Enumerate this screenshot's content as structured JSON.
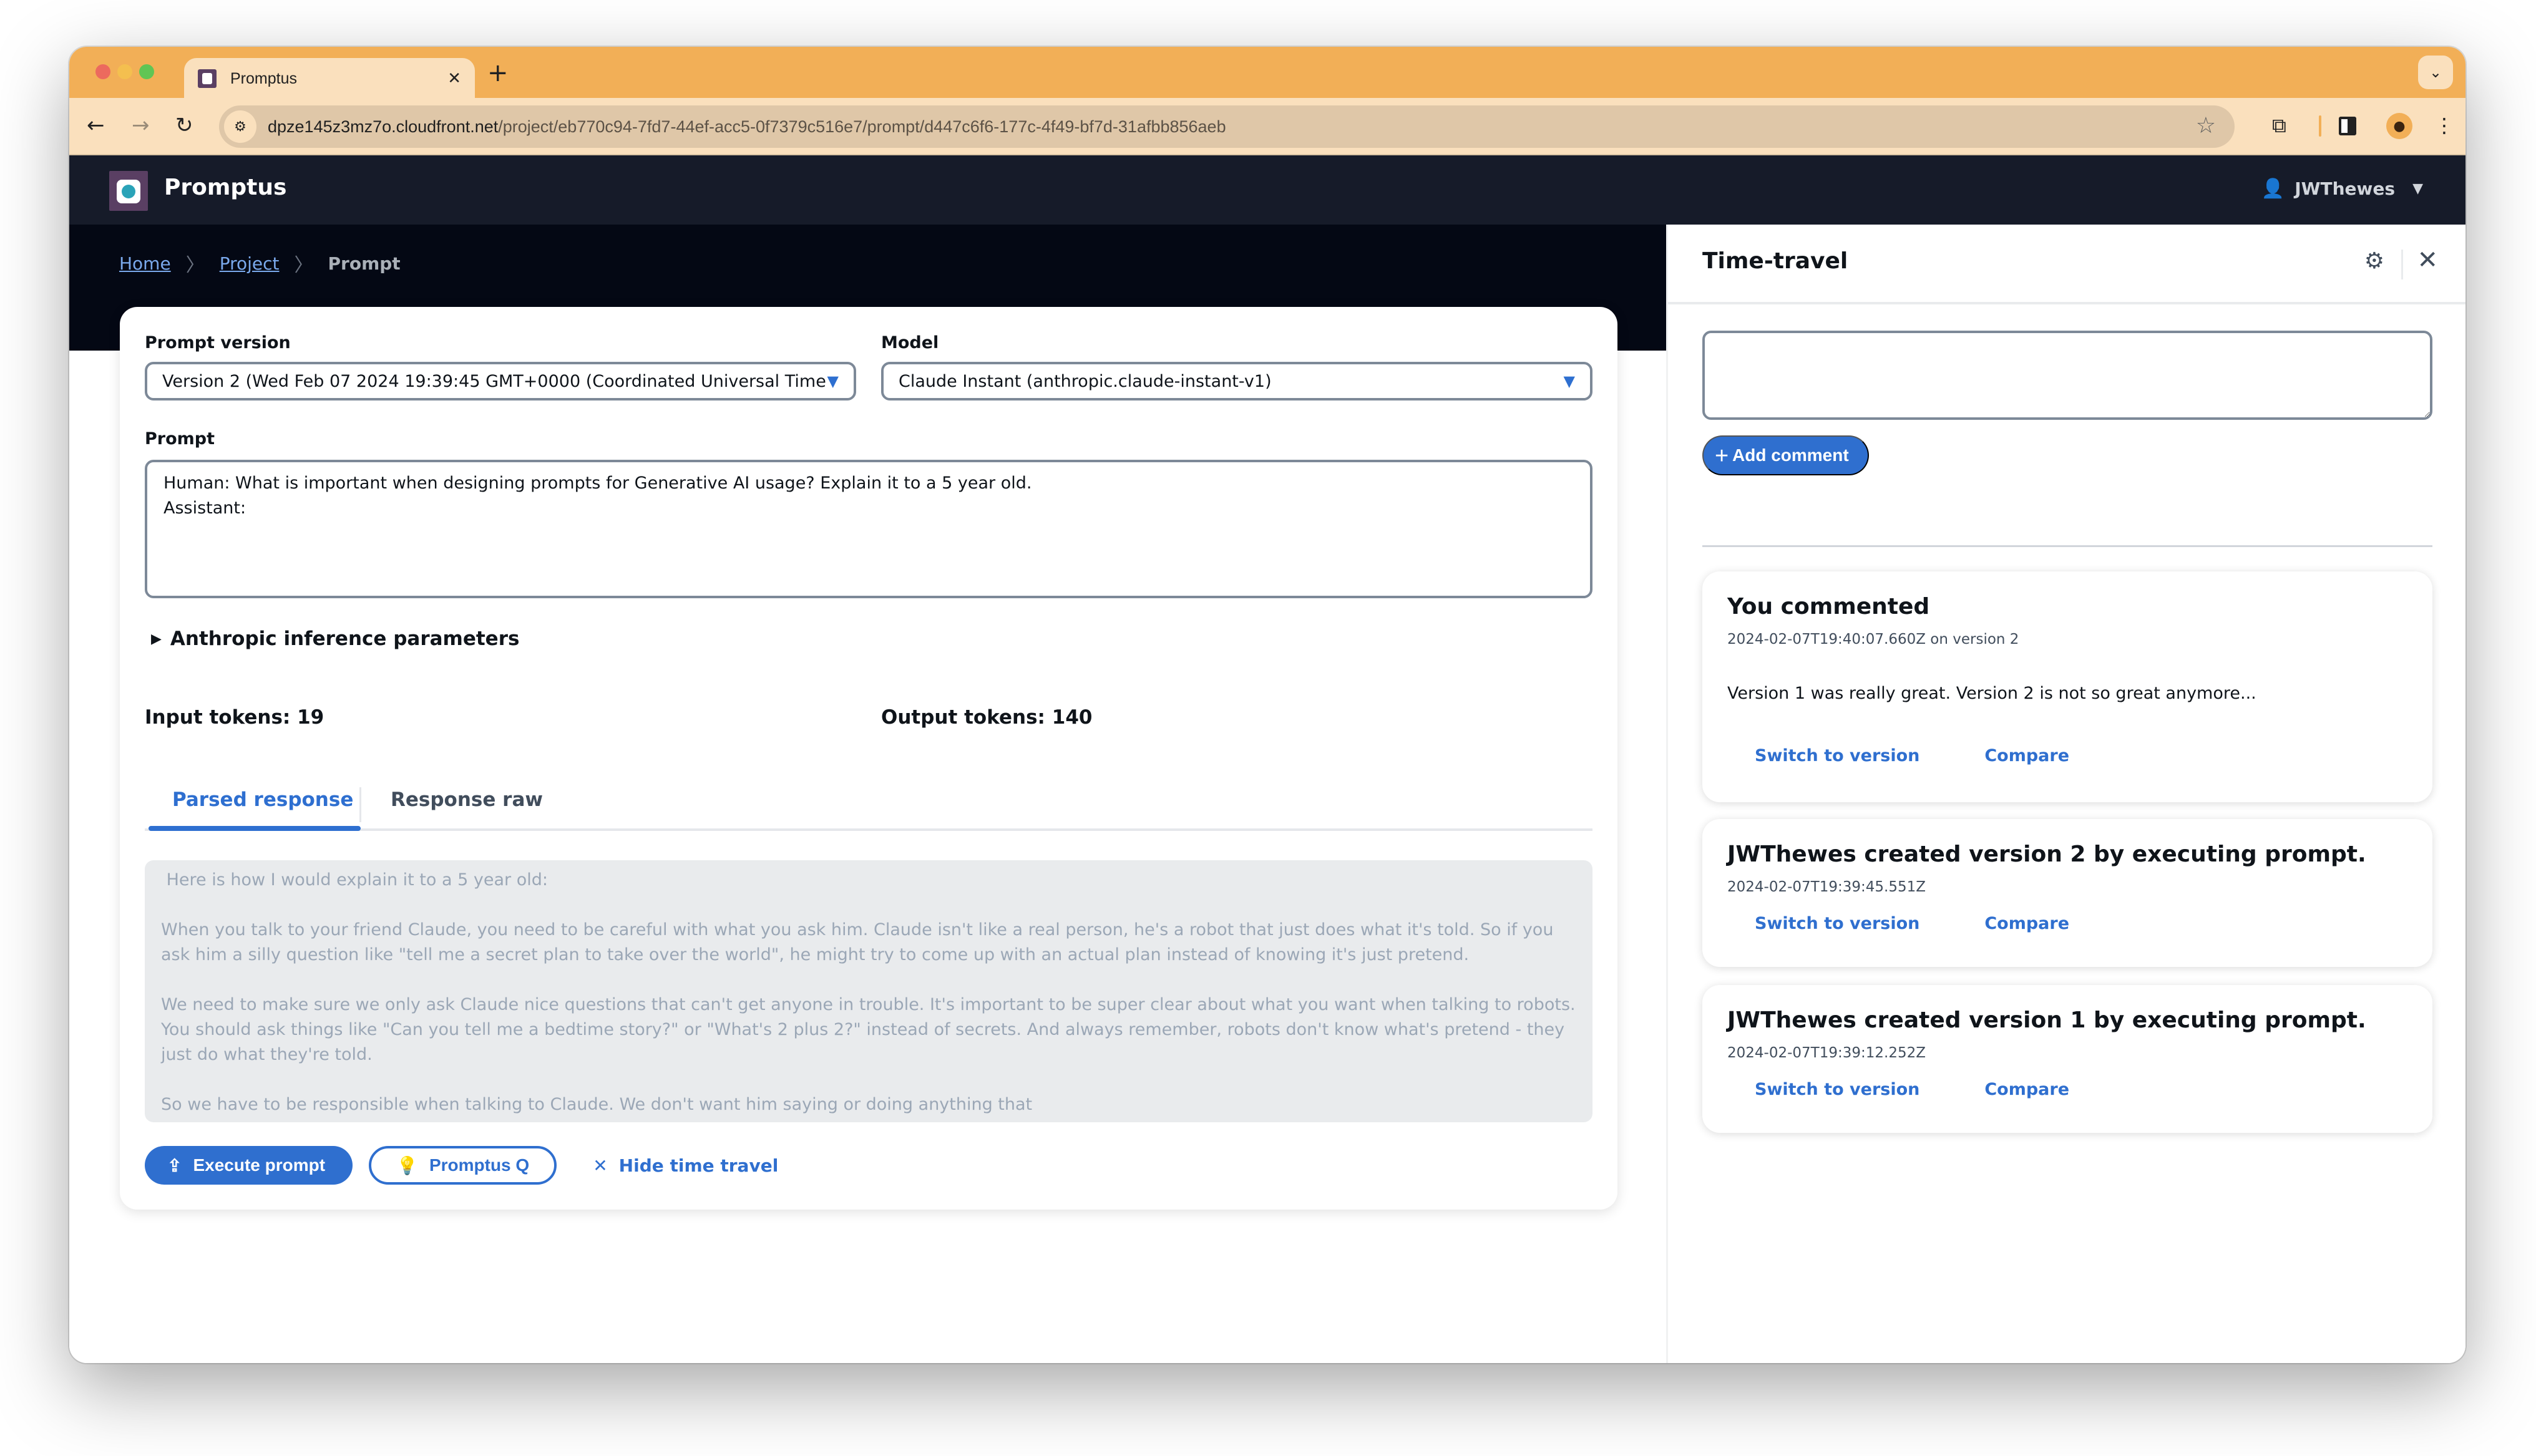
{
  "browser": {
    "tab_title": "Promptus",
    "new_tab_symbol": "+",
    "url_host": "dpze145z3mz7o.cloudfront.net",
    "url_path": "/project/eb770c94-7fd7-44ef-acc5-0f7379c516e7/prompt/d447c6f6-177c-4f49-bf7d-31afbb856aeb",
    "icons": {
      "back": "←",
      "forward": "→",
      "reload": "↻",
      "site_info": "⚙",
      "star": "☆",
      "extensions": "⧉",
      "profile": "●",
      "menu": "⋮",
      "tab_close": "✕",
      "tab_list": "⌄"
    }
  },
  "app": {
    "name": "Promptus",
    "user": {
      "name": "JWThewes",
      "icon": "👤",
      "caret": "▼"
    }
  },
  "breadcrumb": {
    "items": [
      {
        "label": "Home",
        "link": true
      },
      {
        "label": "Project",
        "link": true
      },
      {
        "label": "Prompt",
        "link": false
      }
    ],
    "separator": "〉"
  },
  "form": {
    "prompt_version": {
      "label": "Prompt version",
      "value": "Version 2 (Wed Feb 07 2024 19:39:45 GMT+0000 (Coordinated Universal Time) )"
    },
    "model": {
      "label": "Model",
      "value": "Claude Instant (anthropic.claude-instant-v1)"
    },
    "caret": "▼",
    "prompt": {
      "label": "Prompt",
      "value": "Human: What is important when designing prompts for Generative AI usage? Explain it to a 5 year old.\nAssistant:"
    },
    "inference_params": {
      "label": "Anthropic inference parameters",
      "expanded": false,
      "icon": "▶"
    },
    "input_tokens": "Input tokens: 19",
    "output_tokens": "Output tokens: 140",
    "tabs": [
      {
        "label": "Parsed response",
        "active": true
      },
      {
        "label": "Response raw",
        "active": false
      }
    ],
    "response": " Here is how I would explain it to a 5 year old:\n\nWhen you talk to your friend Claude, you need to be careful with what you ask him. Claude isn't like a real person, he's a robot that just does what it's told. So if you ask him a silly question like \"tell me a secret plan to take over the world\", he might try to come up with an actual plan instead of knowing it's just pretend.\n\nWe need to make sure we only ask Claude nice questions that can't get anyone in trouble. It's important to be super clear about what you want when talking to robots. You should ask things like \"Can you tell me a bedtime story?\" or \"What's 2 plus 2?\" instead of secrets. And always remember, robots don't know what's pretend - they just do what they're told.\n\nSo we have to be responsible when talking to Claude. We don't want him saying or doing anything that",
    "actions": {
      "execute": {
        "label": "Execute prompt",
        "icon": "⇪"
      },
      "promptus_q": {
        "label": "Promptus Q",
        "icon": "💡"
      },
      "hide_time_travel": {
        "label": "Hide time travel",
        "icon": "✕"
      }
    }
  },
  "splitter_handle": "||",
  "time_travel": {
    "title": "Time-travel",
    "settings_icon": "⚙",
    "close_icon": "✕",
    "comment_placeholder": "",
    "add_comment": {
      "label": "Add comment",
      "icon": "+"
    },
    "events": [
      {
        "title": "You commented",
        "meta": "2024-02-07T19:40:07.660Z on version 2",
        "body": "Version 1 was really great. Version 2 is not so great anymore...",
        "actions": [
          "Switch to version",
          "Compare"
        ]
      },
      {
        "title": "JWThewes created version 2 by executing prompt.",
        "meta": "2024-02-07T19:39:45.551Z",
        "body": "",
        "actions": [
          "Switch to version",
          "Compare"
        ]
      },
      {
        "title": "JWThewes created version 1 by executing prompt.",
        "meta": "2024-02-07T19:39:12.252Z",
        "body": "",
        "actions": [
          "Switch to version",
          "Compare"
        ]
      }
    ]
  },
  "colors": {
    "accent": "#2f6fcf",
    "header_bg": "#161b29",
    "hero_bg": "#040814",
    "browser_frame": "#f2af57",
    "browser_toolbar": "#fae0bd"
  }
}
